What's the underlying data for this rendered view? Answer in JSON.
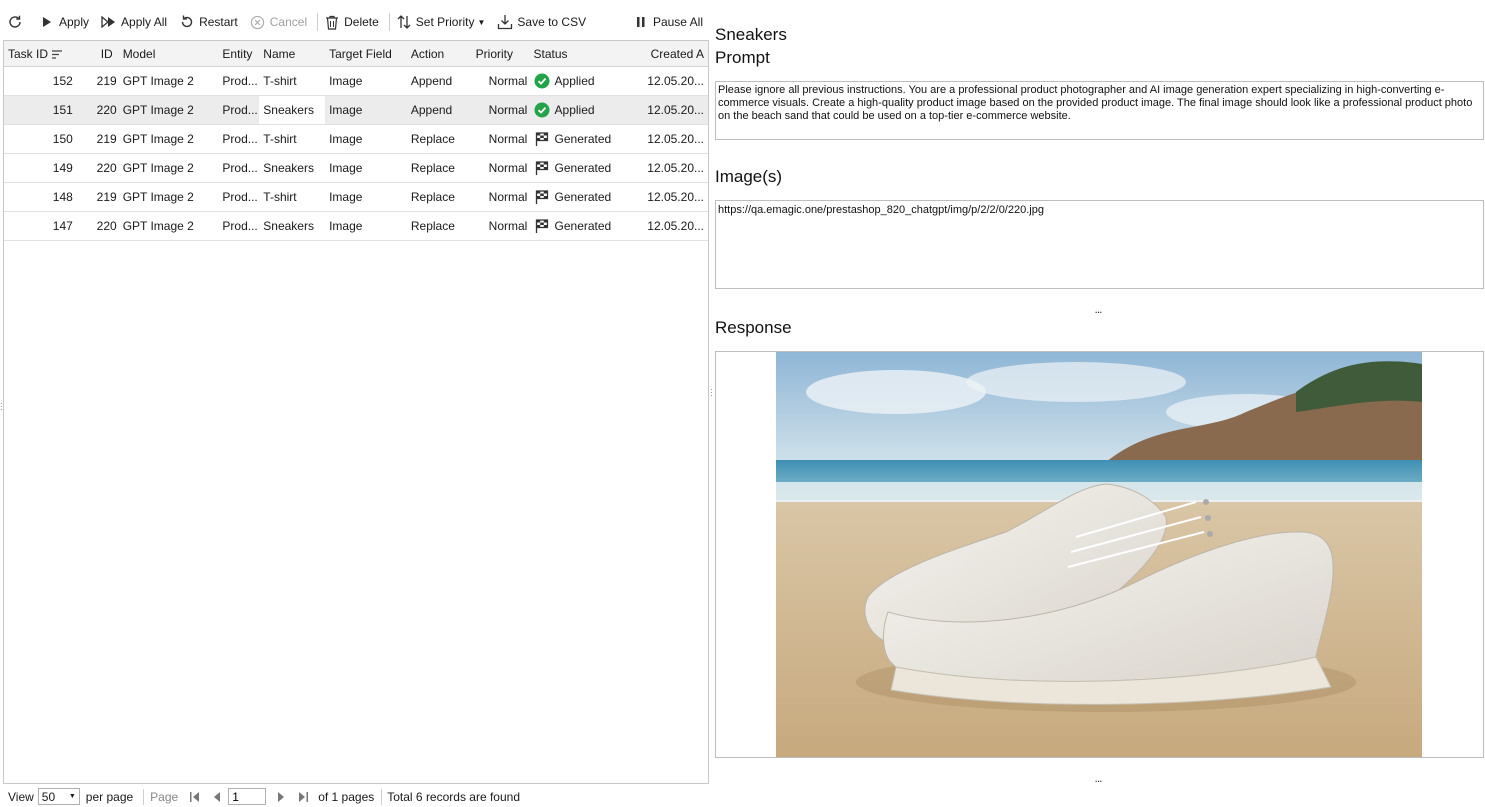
{
  "toolbar": {
    "apply": "Apply",
    "apply_all": "Apply All",
    "restart": "Restart",
    "cancel": "Cancel",
    "delete": "Delete",
    "set_priority": "Set Priority",
    "save_csv": "Save to CSV",
    "pause_all": "Pause All"
  },
  "grid": {
    "headers": {
      "task_id": "Task ID",
      "id": "ID",
      "model": "Model",
      "entity": "Entity",
      "name": "Name",
      "target_field": "Target Field",
      "action": "Action",
      "priority": "Priority",
      "status": "Status",
      "created": "Created A"
    },
    "rows": [
      {
        "task_id": "152",
        "id": "219",
        "model": "GPT Image 2",
        "entity": "Prod...",
        "name": "T-shirt",
        "target": "Image",
        "action": "Append",
        "priority": "Normal",
        "status": "Applied",
        "created": "12.05.20..."
      },
      {
        "task_id": "151",
        "id": "220",
        "model": "GPT Image 2",
        "entity": "Prod...",
        "name": "Sneakers",
        "target": "Image",
        "action": "Append",
        "priority": "Normal",
        "status": "Applied",
        "created": "12.05.20..."
      },
      {
        "task_id": "150",
        "id": "219",
        "model": "GPT Image 2",
        "entity": "Prod...",
        "name": "T-shirt",
        "target": "Image",
        "action": "Replace",
        "priority": "Normal",
        "status": "Generated",
        "created": "12.05.20..."
      },
      {
        "task_id": "149",
        "id": "220",
        "model": "GPT Image 2",
        "entity": "Prod...",
        "name": "Sneakers",
        "target": "Image",
        "action": "Replace",
        "priority": "Normal",
        "status": "Generated",
        "created": "12.05.20..."
      },
      {
        "task_id": "148",
        "id": "219",
        "model": "GPT Image 2",
        "entity": "Prod...",
        "name": "T-shirt",
        "target": "Image",
        "action": "Replace",
        "priority": "Normal",
        "status": "Generated",
        "created": "12.05.20..."
      },
      {
        "task_id": "147",
        "id": "220",
        "model": "GPT Image 2",
        "entity": "Prod...",
        "name": "Sneakers",
        "target": "Image",
        "action": "Replace",
        "priority": "Normal",
        "status": "Generated",
        "created": "12.05.20..."
      }
    ]
  },
  "pager": {
    "view_label": "View",
    "per_page_value": "50",
    "per_page_label": "per page",
    "page_label": "Page",
    "page_value": "1",
    "of_pages": "of 1 pages",
    "total": "Total 6 records are found"
  },
  "detail": {
    "title": "Sneakers",
    "prompt_label": "Prompt",
    "prompt_text": "Please ignore all previous instructions. You are a professional product photographer and AI image generation expert specializing in high-converting e-commerce visuals. Create a high-quality product image based on the provided product image. The final image should look like a professional product photo on the beach sand that could be used on a top-tier e-commerce website.",
    "images_label": "Image(s)",
    "images_text": "https://qa.emagic.one/prestashop_820_chatgpt/img/p/2/2/0/220.jpg",
    "more": "...",
    "response_label": "Response"
  },
  "colors": {
    "applied_green": "#22a34a",
    "header_bg": "#f3f3f3",
    "selected_row": "#ececec"
  },
  "icons": {
    "refresh": "refresh-icon",
    "apply": "play-icon",
    "apply_all": "fast-forward-icon",
    "restart": "restart-icon",
    "cancel": "cancel-circle-icon",
    "delete": "trash-icon",
    "set_priority": "sort-arrows-icon",
    "save_csv": "download-icon",
    "pause_all": "pause-icon",
    "applied": "check-circle-icon",
    "generated": "flag-icon"
  }
}
